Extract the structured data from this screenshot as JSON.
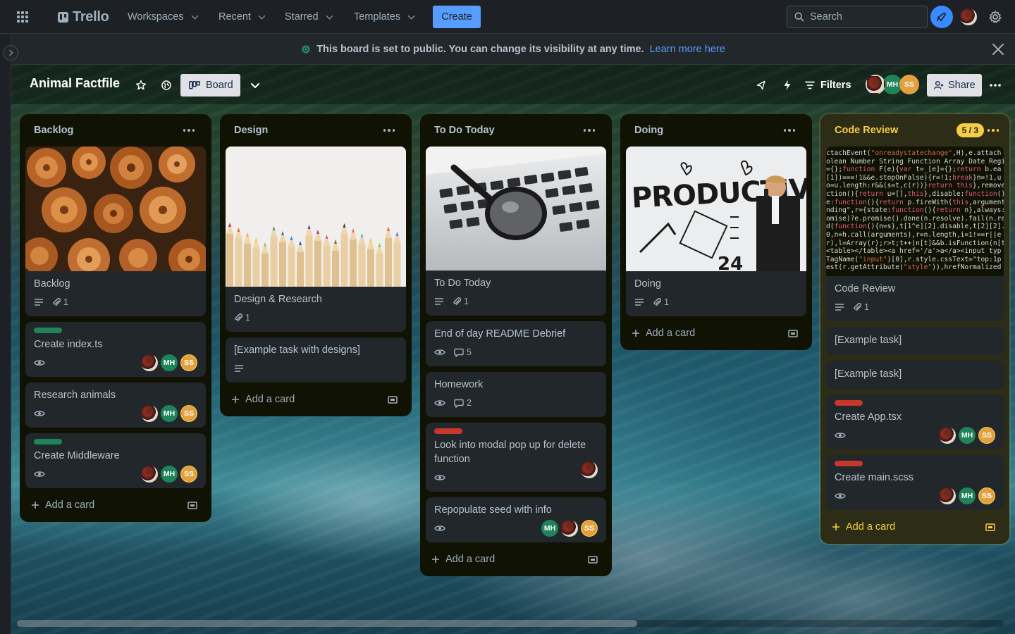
{
  "nav": {
    "logo": "Trello",
    "menus": [
      "Workspaces",
      "Recent",
      "Starred",
      "Templates"
    ],
    "create": "Create",
    "search_placeholder": "Search"
  },
  "banner": {
    "message": "This board is set to public. You can change its visibility at any time.",
    "link": "Learn more here"
  },
  "board": {
    "title": "Animal Factfile",
    "view": "Board",
    "filters": "Filters",
    "share": "Share",
    "members": [
      "MH",
      "SS"
    ]
  },
  "lists": {
    "backlog": {
      "title": "Backlog",
      "cover_card": {
        "title": "Backlog",
        "attachments": "1"
      },
      "cards": [
        {
          "title": "Create index.ts",
          "label_color": "#1f845a",
          "members": [
            "MH",
            "SS"
          ]
        },
        {
          "title": "Research animals",
          "members": [
            "MH",
            "SS"
          ]
        },
        {
          "title": "Create Middleware",
          "label_color": "#1f845a",
          "members": [
            "MH",
            "SS"
          ]
        }
      ],
      "add": "Add a card"
    },
    "design": {
      "title": "Design",
      "cover_card": {
        "title": "Design & Research",
        "attachments": "1"
      },
      "cards": [
        {
          "title": "[Example task with designs]"
        }
      ],
      "add": "Add a card"
    },
    "todo": {
      "title": "To Do Today",
      "cover_card": {
        "title": "To Do Today",
        "attachments": "1"
      },
      "cards": [
        {
          "title": "End of day README Debrief",
          "comments": "5"
        },
        {
          "title": "Homework",
          "comments": "2"
        },
        {
          "title": "Look into modal pop up for delete function",
          "label_color": "#c9372c"
        },
        {
          "title": "Repopulate seed with info",
          "members": [
            "MH",
            "SS"
          ]
        }
      ],
      "add": "Add a card"
    },
    "doing": {
      "title": "Doing",
      "cover_card": {
        "title": "Doing",
        "attachments": "1"
      },
      "add": "Add a card"
    },
    "code_review": {
      "title": "Code Review",
      "wip": "5 / 3",
      "cover_card": {
        "title": "Code Review",
        "attachments": "1"
      },
      "cards": [
        {
          "title": "[Example task]"
        },
        {
          "title": "[Example task]"
        },
        {
          "title": "Create App.tsx",
          "label_color": "#c9372c",
          "members": [
            "MH",
            "SS"
          ]
        },
        {
          "title": "Create main.scss",
          "label_color": "#c9372c",
          "members": [
            "MH",
            "SS"
          ]
        }
      ],
      "add": "Add a card"
    }
  },
  "code_snippet": [
    "ctachEvent(\"onreadystatechange\",H),e.attach",
    "olean Number String Function Array Date Regi",
    "={};function F(e){var t=_[e]={};return b.ea",
    "[1])===!1&&e.stopOnFalse){r=!1;break}n=!1,u",
    "o=u.length:r&&(s=t,c(r))}return this},remove",
    "ction(){return u=[],this},disable:function()",
    "e:function(){return p.fireWith(this,argument",
    "nding\",r={state:function(){return n},always:",
    "omise)?e.promise().done(n.resolve).fail(n.re",
    "d(function(){n=s},t[1^e][2].disable,t[2][2].",
    "0,n=h.call(arguments),r=n.length,i=1!==r||e",
    "r),l=Array(r);r>t;t++)n[t]&&b.isFunction(n[t",
    "<table></table><a href='/a'>a</a><input typ",
    "TagName(\"input\")[0],r.style.cssText=\"top:1p",
    "est(r.getAttribute(\"style\")),hrefNormalized"
  ]
}
